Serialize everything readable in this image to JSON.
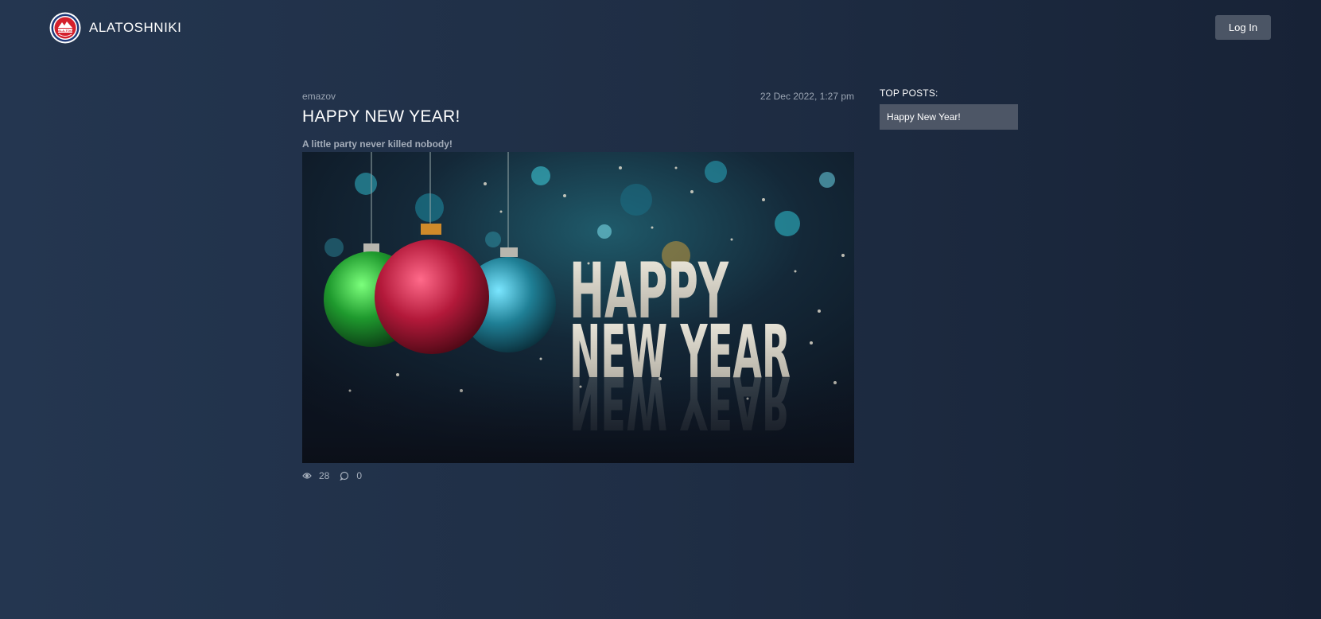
{
  "header": {
    "brand_name": "ALATOSHNIKI",
    "logo_text": "ALA-TOO",
    "login_label": "Log In"
  },
  "post": {
    "author": "emazov",
    "date": "22 Dec 2022, 1:27 pm",
    "title": "HAPPY NEW YEAR!",
    "excerpt": "A little party never killed nobody!",
    "image": {
      "line1": "HAPPY",
      "line2": "NEW YEAR"
    },
    "stats": {
      "views": "28",
      "comments": "0"
    }
  },
  "sidebar": {
    "title": "TOP POSTS:",
    "items": [
      {
        "label": "Happy New Year!"
      }
    ]
  },
  "icons": {
    "views": "eye-icon",
    "comments": "comment-icon"
  },
  "colors": {
    "accent_button": "#4b5565",
    "logo_red": "#d4202c"
  }
}
